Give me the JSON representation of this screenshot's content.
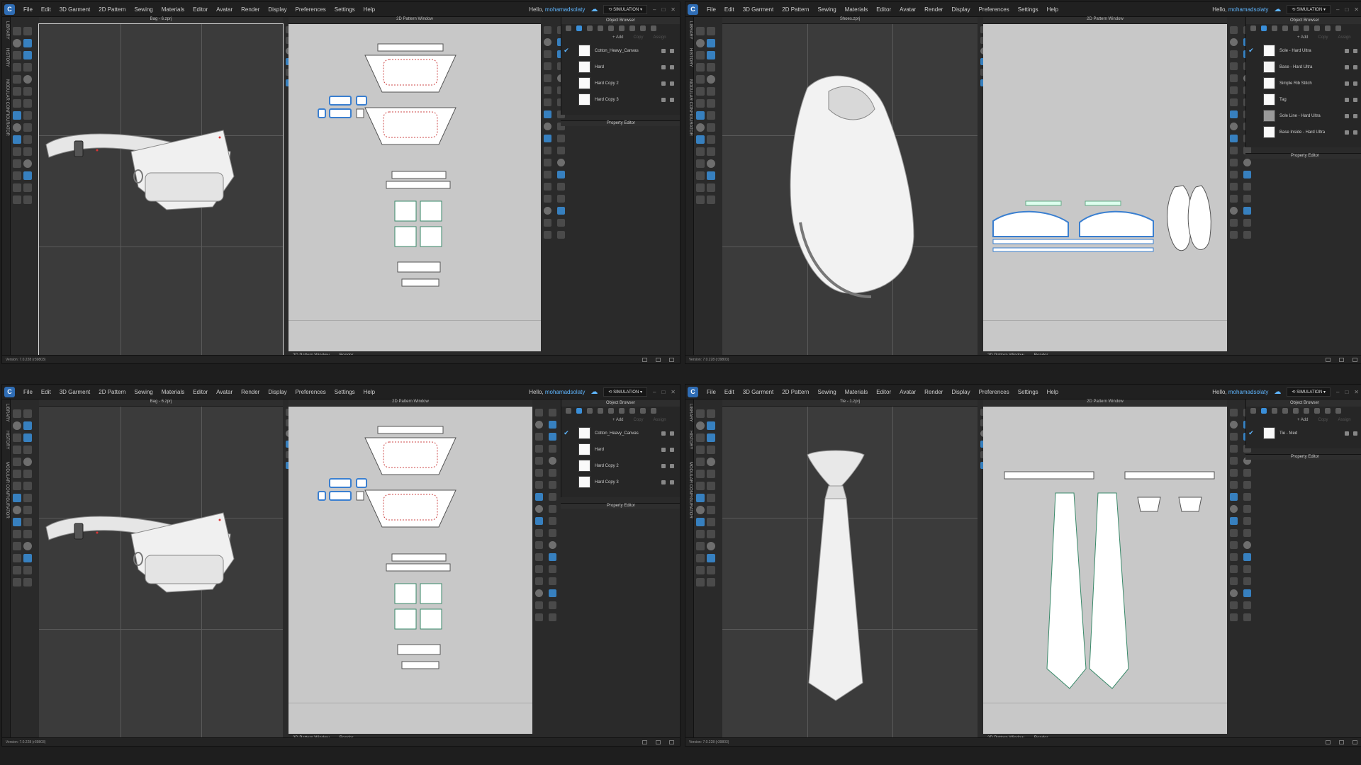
{
  "menu": [
    "File",
    "Edit",
    "3D Garment",
    "2D Pattern",
    "Sewing",
    "Materials",
    "Editor",
    "Avatar",
    "Render",
    "Display",
    "Preferences",
    "Settings",
    "Help"
  ],
  "user": {
    "greeting": "Hello,",
    "name": "mohamadsolaty"
  },
  "simulation_label": "SIMULATION",
  "side_tabs": [
    "LIBRARY",
    "HISTORY",
    "MODULAR CONFIGURATOR"
  ],
  "pattern_window_title": "2D Pattern Window",
  "object_browser_title": "Object Browser",
  "property_editor_title": "Property Editor",
  "add_label": "+ Add",
  "copy_label": "Copy",
  "assign_label": "Assign",
  "bottom_tabs": [
    "2D Pattern Window",
    "Render"
  ],
  "version": "Version: 7.0.228 (r39803)",
  "icons": {
    "logo": "clo-logo-icon",
    "check": "checkmark-icon",
    "cloud": "cloud-icon",
    "sim": "simulation-icon"
  },
  "accent": "#3a8fd9",
  "windows": [
    {
      "file": "Bag - 6.zprj",
      "fabrics": [
        {
          "name": "Cotton_Heavy_Canvas",
          "checked": true
        },
        {
          "name": "Hard",
          "checked": false
        },
        {
          "name": "Hard Copy 2",
          "checked": false
        },
        {
          "name": "Hard Copy 3",
          "checked": false
        }
      ]
    },
    {
      "file": "Shoes.zprj",
      "fabrics": [
        {
          "name": "Sole - Hard Ultra",
          "checked": true
        },
        {
          "name": "Base - Hard Ultra",
          "checked": false
        },
        {
          "name": "Simple Rib Stitch",
          "checked": false
        },
        {
          "name": "Tag",
          "checked": false
        },
        {
          "name": "Sole Line - Hard Ultra",
          "checked": false
        },
        {
          "name": "Base Inside - Hard Ultra",
          "checked": false
        }
      ]
    },
    {
      "file": "Bag - 6.zprj",
      "fabrics": [
        {
          "name": "Cotton_Heavy_Canvas",
          "checked": true
        },
        {
          "name": "Hard",
          "checked": false
        },
        {
          "name": "Hard Copy 2",
          "checked": false
        },
        {
          "name": "Hard Copy 3",
          "checked": false
        }
      ]
    },
    {
      "file": "Tie - 1.zprj",
      "fabrics": [
        {
          "name": "Tie - Med",
          "checked": true
        }
      ]
    }
  ]
}
